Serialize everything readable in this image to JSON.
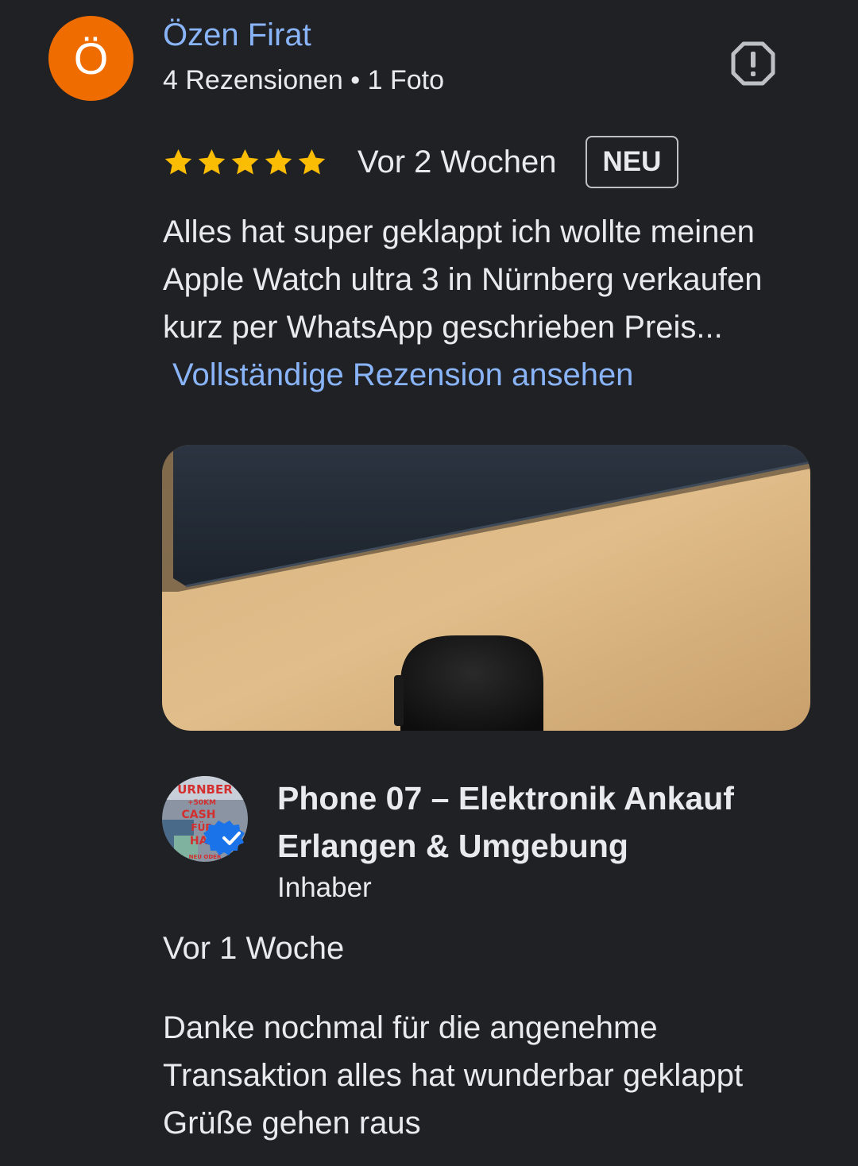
{
  "review": {
    "avatar_letter": "Ö",
    "avatar_color": "#ef6c00",
    "reviewer_name": "Özen Firat",
    "reviewer_meta": "4 Rezensionen • 1 Foto",
    "report_icon": "report-icon",
    "rating": 5,
    "rating_max": 5,
    "star_color": "#fbbc04",
    "date": "Vor 2 Wochen",
    "badge": "NEU",
    "text_lines": [
      "Alles hat super geklappt ich wollte meinen",
      "Apple Watch ultra 3 in Nürnberg verkaufen",
      "kurz per WhatsApp geschrieben Preis..."
    ],
    "read_more": "Vollständige Rezension ansehen"
  },
  "owner_reply": {
    "logo_text": [
      "URNBER",
      "+50KM",
      "CASH",
      "FÜR",
      "HAN",
      "NEU ODER"
    ],
    "verified_icon": "verified-badge-icon",
    "name_lines": [
      "Phone 07 – Elektronik Ankauf",
      "Erlangen & Umgebung"
    ],
    "role": "Inhaber",
    "date": "Vor 1 Woche",
    "text_lines": [
      "Danke nochmal für die angenehme",
      "Transaktion alles hat wunderbar geklappt",
      "Grüße gehen raus"
    ]
  },
  "colors": {
    "background": "#202124",
    "text": "#e8eaed",
    "link": "#8ab4f8",
    "verified": "#1a73e8"
  }
}
